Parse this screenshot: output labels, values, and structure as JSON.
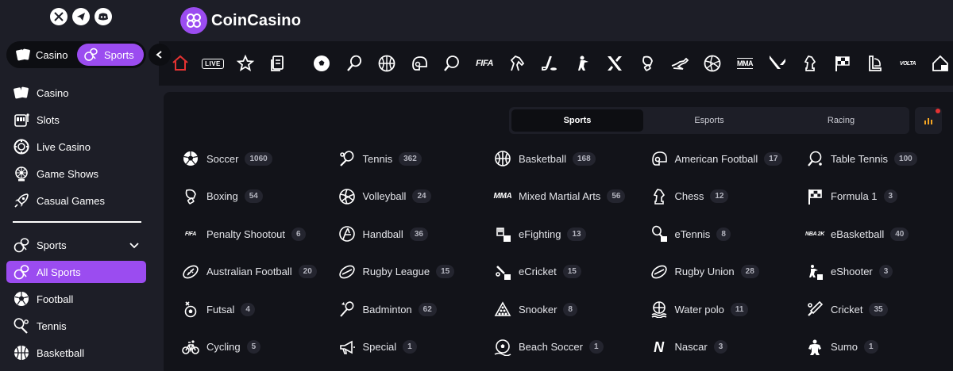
{
  "brand": {
    "name": "CoinCasino",
    "accent": "#9b4cf0",
    "background": "#1d1e27",
    "panel": "#121319"
  },
  "socials": [
    {
      "icon": "x-icon",
      "glyph": "𝕏"
    },
    {
      "icon": "telegram-icon",
      "glyph": "➤"
    },
    {
      "icon": "discord-icon",
      "glyph": "◉"
    }
  ],
  "switcher": {
    "casino_label": "Casino",
    "sports_label": "Sports",
    "active": "Sports"
  },
  "sidebar": {
    "top_items": [
      {
        "label": "Casino",
        "icon": "cards-icon"
      },
      {
        "label": "Slots",
        "icon": "slot-machine-icon"
      },
      {
        "label": "Live Casino",
        "icon": "roulette-chip-icon"
      },
      {
        "label": "Game Shows",
        "icon": "wheel-icon"
      },
      {
        "label": "Casual Games",
        "icon": "rocket-icon"
      }
    ],
    "sports_section": {
      "label": "Sports",
      "icon": "sports-icon",
      "items": [
        {
          "label": "All Sports",
          "icon": "sports-icon",
          "active": true
        },
        {
          "label": "Football",
          "icon": "soccer-ball-icon"
        },
        {
          "label": "Tennis",
          "icon": "tennis-racket-icon"
        },
        {
          "label": "Basketball",
          "icon": "basketball-icon"
        }
      ]
    }
  },
  "sportbar": {
    "live_label": "LIVE",
    "fifa_label": "FIFA",
    "mma_label": "MMA",
    "volta_label": "VOLTA",
    "icons": [
      "home-icon",
      "live-icon",
      "star-icon",
      "betslip-icon",
      "soccer-ball-icon",
      "tennis-icon",
      "basketball-icon",
      "american-football-icon",
      "table-tennis-icon",
      "fifa-icon",
      "horse-racing-icon",
      "ice-hockey-icon",
      "shooter-icon",
      "esports-icon",
      "boxing-icon",
      "greyhound-icon",
      "volleyball-icon",
      "mma-icon",
      "valorant-icon",
      "chess-icon",
      "formula-flag-icon",
      "league-icon",
      "volta-icon",
      "ebasketball-icon"
    ]
  },
  "tabs": {
    "items": [
      "Sports",
      "Esports",
      "Racing"
    ],
    "active": "Sports"
  },
  "sports": [
    {
      "name": "Soccer",
      "count": "1060",
      "icon": "soccer-ball-icon"
    },
    {
      "name": "Tennis",
      "count": "362",
      "icon": "tennis-racket-icon"
    },
    {
      "name": "Basketball",
      "count": "168",
      "icon": "basketball-icon"
    },
    {
      "name": "American Football",
      "count": "17",
      "icon": "american-football-helmet-icon"
    },
    {
      "name": "Table Tennis",
      "count": "100",
      "icon": "table-tennis-icon"
    },
    {
      "name": "Boxing",
      "count": "54",
      "icon": "boxing-glove-icon"
    },
    {
      "name": "Volleyball",
      "count": "24",
      "icon": "volleyball-icon"
    },
    {
      "name": "Mixed Martial Arts",
      "count": "56",
      "icon": "mma-icon",
      "text": "MMA"
    },
    {
      "name": "Chess",
      "count": "12",
      "icon": "chess-knight-icon"
    },
    {
      "name": "Formula 1",
      "count": "3",
      "icon": "checkered-flag-icon"
    },
    {
      "name": "Penalty Shootout",
      "count": "6",
      "icon": "fifa-icon",
      "text": "FIFA"
    },
    {
      "name": "Handball",
      "count": "36",
      "icon": "handball-icon"
    },
    {
      "name": "eFighting",
      "count": "13",
      "icon": "efighting-icon"
    },
    {
      "name": "eTennis",
      "count": "8",
      "icon": "etennis-icon"
    },
    {
      "name": "eBasketball",
      "count": "40",
      "icon": "nba2k-icon",
      "text": "NBA 2K"
    },
    {
      "name": "Australian Football",
      "count": "20",
      "icon": "aussie-rules-ball-icon"
    },
    {
      "name": "Rugby League",
      "count": "15",
      "icon": "rugby-ball-icon"
    },
    {
      "name": "eCricket",
      "count": "15",
      "icon": "ecricket-icon"
    },
    {
      "name": "Rugby Union",
      "count": "28",
      "icon": "rugby-ball-icon"
    },
    {
      "name": "eShooter",
      "count": "3",
      "icon": "eshooter-icon"
    },
    {
      "name": "Futsal",
      "count": "4",
      "icon": "futsal-icon"
    },
    {
      "name": "Badminton",
      "count": "62",
      "icon": "badminton-icon"
    },
    {
      "name": "Snooker",
      "count": "8",
      "icon": "snooker-icon"
    },
    {
      "name": "Water polo",
      "count": "11",
      "icon": "water-polo-icon"
    },
    {
      "name": "Cricket",
      "count": "35",
      "icon": "cricket-bat-icon"
    },
    {
      "name": "Cycling",
      "count": "5",
      "icon": "bicycle-icon"
    },
    {
      "name": "Special",
      "count": "1",
      "icon": "megaphone-icon"
    },
    {
      "name": "Beach Soccer",
      "count": "1",
      "icon": "beach-soccer-icon"
    },
    {
      "name": "Nascar",
      "count": "3",
      "icon": "nascar-icon",
      "text": "N"
    },
    {
      "name": "Sumo",
      "count": "1",
      "icon": "sumo-icon"
    }
  ]
}
